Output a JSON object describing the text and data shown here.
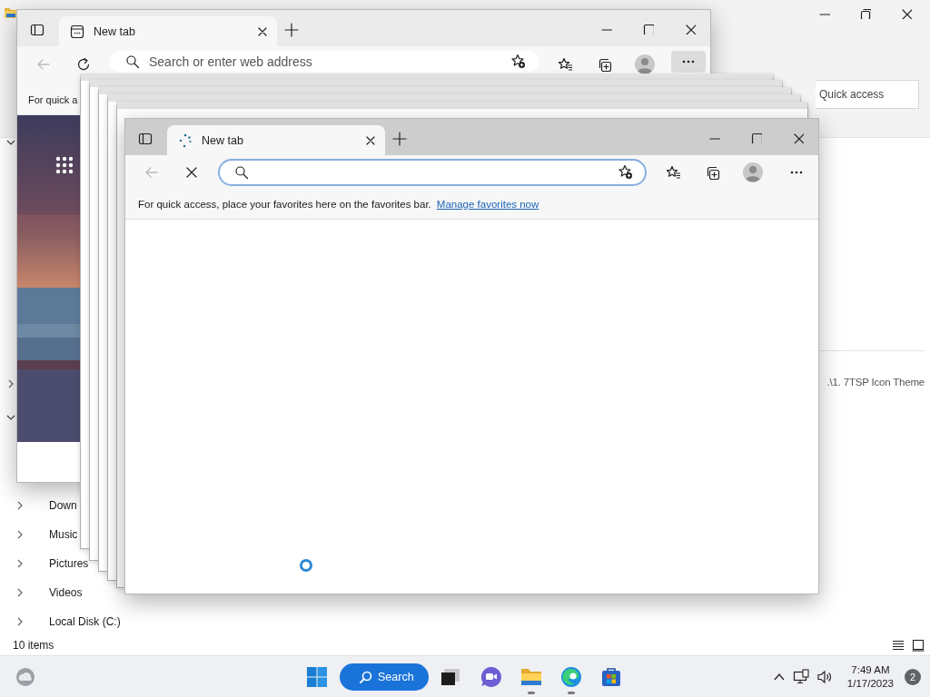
{
  "explorer": {
    "search": {
      "placeholder": "Quick access"
    },
    "nav_items": [
      {
        "label": "Down"
      },
      {
        "label": "Music"
      },
      {
        "label": "Pictures"
      },
      {
        "label": "Videos"
      },
      {
        "label": "Local Disk (C:)"
      }
    ],
    "path_text": ".\\1. 7TSP Icon Theme",
    "status_bar": "10 items"
  },
  "back_browser": {
    "tab_title": "New tab",
    "loading": false,
    "address": {
      "placeholder": "Search or enter web address",
      "focused": false
    },
    "more_highlighted": true,
    "favorites_bar_text": "For quick a"
  },
  "stacked_windows": [
    {
      "kind": "frame"
    },
    {
      "kind": "frame"
    },
    {
      "kind": "frame"
    },
    {
      "kind": "frame"
    },
    {
      "kind": "frame"
    }
  ],
  "front_browser": {
    "tab_title": "New tab",
    "loading": true,
    "address": {
      "focused": true
    },
    "more_highlighted": false,
    "favorites_bar_text": "For quick access, place your favorites here on the favorites bar.",
    "favorites_link": "Manage favorites now"
  },
  "taskbar": {
    "search_label": "Search",
    "apps": [
      {
        "kind": "task-view",
        "running": false
      },
      {
        "kind": "chat",
        "running": false
      },
      {
        "kind": "explorer",
        "running": true
      },
      {
        "kind": "edge",
        "running": true
      },
      {
        "kind": "store",
        "running": false
      }
    ],
    "time": "7:49 AM",
    "date": "1/17/2023",
    "notification_count": "2"
  }
}
